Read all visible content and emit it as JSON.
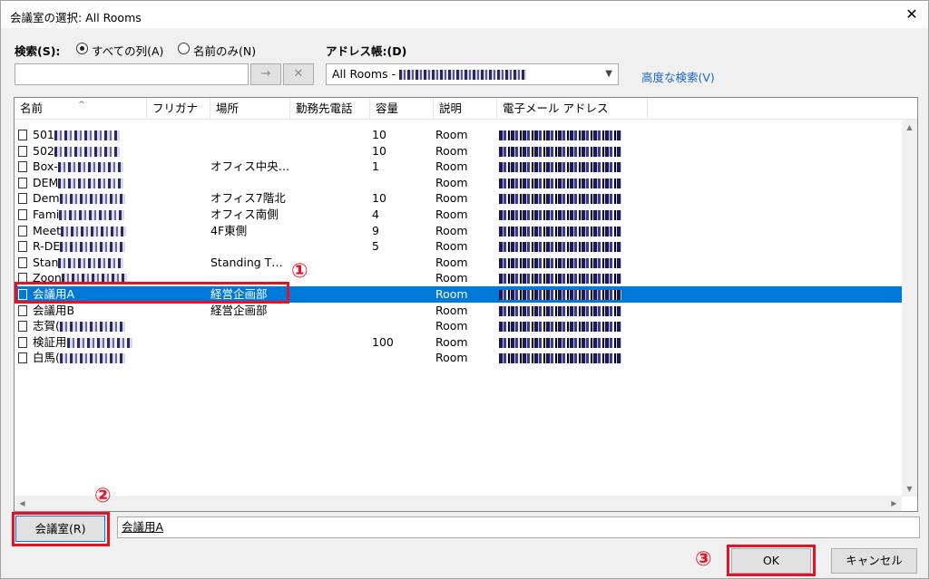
{
  "window": {
    "title": "会議室の選択: All Rooms",
    "close_label": "✕"
  },
  "search": {
    "label": "検索(S):",
    "option_all": "すべての列(A)",
    "option_name": "名前のみ(N)",
    "value": "",
    "go_label": "→",
    "clear_label": "✕"
  },
  "address_book": {
    "label": "アドレス帳:(D)",
    "selected": "All Rooms - ",
    "advanced_search": "高度な検索(V)"
  },
  "columns": [
    "名前",
    "フリガナ",
    "場所",
    "勤務先電話",
    "容量",
    "説明",
    "電子メール アドレス"
  ],
  "rows": [
    {
      "name": "501",
      "location": "",
      "capacity": "10",
      "desc": "Room"
    },
    {
      "name": "502",
      "location": "",
      "capacity": "10",
      "desc": "Room"
    },
    {
      "name": "Box-",
      "location": "オフィス中央…",
      "capacity": "1",
      "desc": "Room"
    },
    {
      "name": "DEM",
      "location": "",
      "capacity": "",
      "desc": "Room"
    },
    {
      "name": "Dem",
      "location": "オフィス7階北",
      "capacity": "10",
      "desc": "Room"
    },
    {
      "name": "Fami",
      "location": "オフィス南側",
      "capacity": "4",
      "desc": "Room"
    },
    {
      "name": "Meet",
      "location": "4F東側",
      "capacity": "9",
      "desc": "Room"
    },
    {
      "name": "R-DE",
      "location": "",
      "capacity": "5",
      "desc": "Room"
    },
    {
      "name": "Stan",
      "location": "Standing T…",
      "capacity": "",
      "desc": "Room"
    },
    {
      "name": "Zoon",
      "location": "",
      "capacity": "",
      "desc": "Room"
    },
    {
      "name": "会議用A",
      "location": "経営企画部",
      "capacity": "",
      "desc": "Room"
    },
    {
      "name": "会議用B",
      "location": "経営企画部",
      "capacity": "",
      "desc": "Room"
    },
    {
      "name": "志賀(",
      "location": "",
      "capacity": "",
      "desc": "Room"
    },
    {
      "name": "検証用",
      "location": "",
      "capacity": "100",
      "desc": "Room"
    },
    {
      "name": "白馬(",
      "location": "",
      "capacity": "",
      "desc": "Room"
    }
  ],
  "selected_row_index": 10,
  "room_button": "会議室(R)",
  "room_field_value": "会議用A",
  "ok_label": "OK",
  "cancel_label": "キャンセル",
  "markers": [
    "①",
    "②",
    "③"
  ],
  "colors": {
    "selection": "#0078d7",
    "highlight": "#e81123",
    "link": "#1b66c9"
  }
}
